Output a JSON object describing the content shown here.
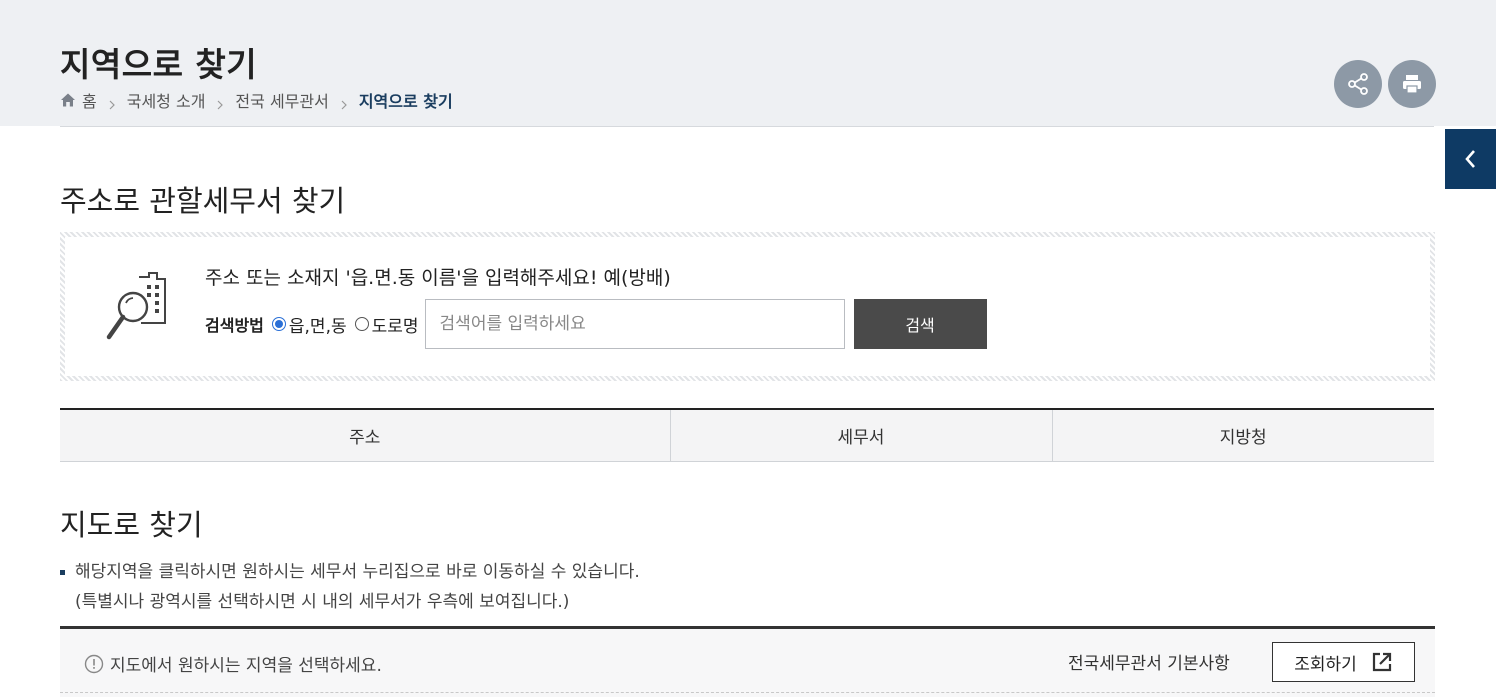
{
  "header": {
    "title": "지역으로 찾기",
    "breadcrumb": [
      "홈",
      "국세청 소개",
      "전국 세무관서",
      "지역으로 찾기"
    ]
  },
  "icons": {
    "home": "home-icon",
    "share": "share-icon",
    "print": "print-icon",
    "side_tab": "chevron-left-icon",
    "search_illustration": "magnifier-building-icon",
    "info": "info-icon",
    "external": "external-link-icon"
  },
  "address_search": {
    "title": "주소로 관할세무서 찾기",
    "guide": "주소 또는 소재지 '읍.면.동 이름'을 입력해주세요! 예(방배)",
    "method_label": "검색방법",
    "options": [
      "읍,면,동",
      "도로명"
    ],
    "selected_option": "읍,면,동",
    "input_value": "",
    "input_placeholder": "검색어를 입력하세요",
    "button_label": "검색"
  },
  "result_table": {
    "headers": [
      "주소",
      "세무서",
      "지방청"
    ],
    "rows": []
  },
  "map_search": {
    "title": "지도로 찾기",
    "notes": [
      "해당지역을 클릭하시면 원하시는 세무서 누리집으로 바로 이동하실 수 있습니다.",
      "(특별시나 광역시를 선택하시면 시 내의 세무서가 우측에 보여집니다.)"
    ],
    "info_text": "지도에서 원하시는 지역을 선택하세요.",
    "basic_info_label": "전국세무관서 기본사항",
    "inquiry_button": "조회하기"
  },
  "colors": {
    "top_band": "#eef0f3",
    "side_tab": "#0e3a64",
    "search_button": "#4a4a4a",
    "circle_button": "#8d99a6",
    "breadcrumb_current": "#1a3d5f"
  }
}
